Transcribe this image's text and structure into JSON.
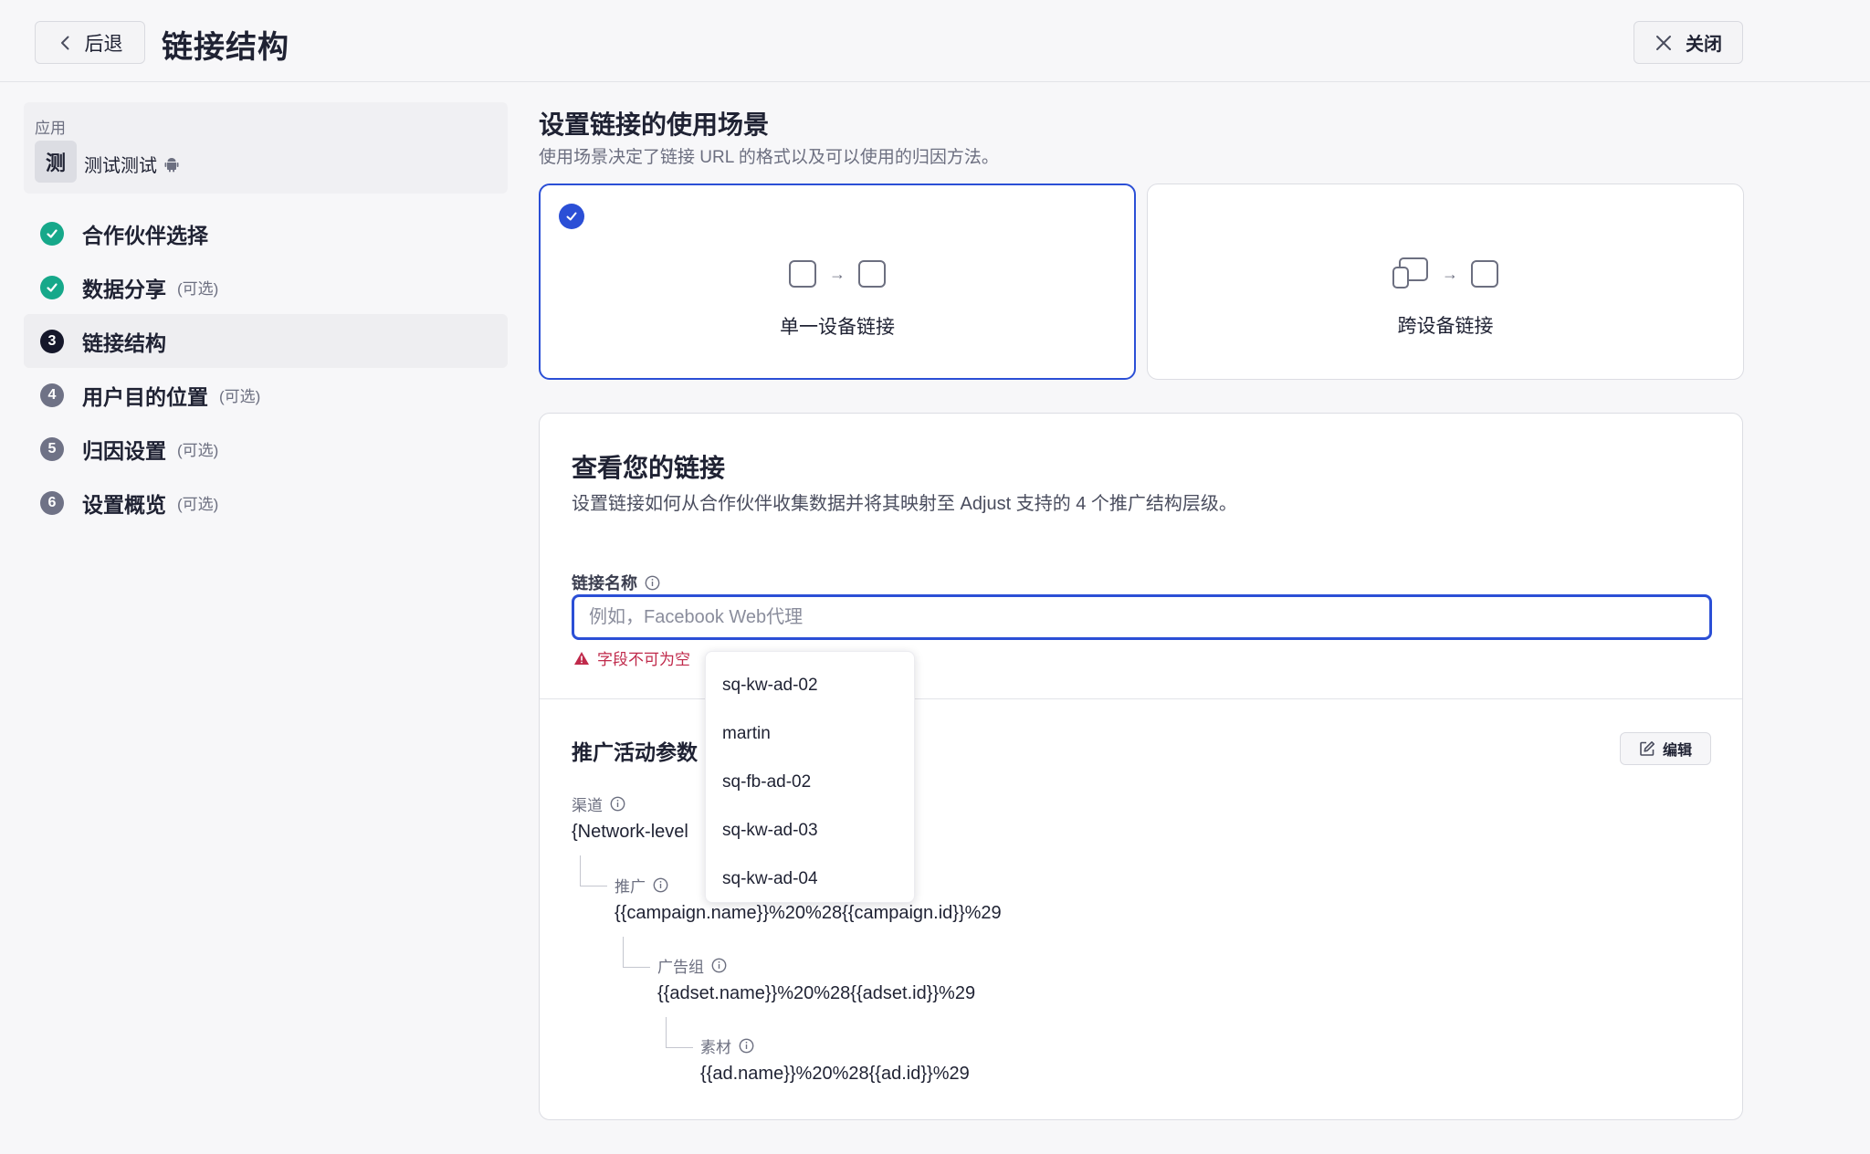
{
  "header": {
    "back_label": "后退",
    "title": "链接结构",
    "close_label": "关闭"
  },
  "app": {
    "label": "应用",
    "avatar": "测",
    "name": "测试测试"
  },
  "steps": [
    {
      "label": "合作伙伴选择",
      "status": "done",
      "optional": ""
    },
    {
      "label": "数据分享",
      "status": "done",
      "optional": "(可选)"
    },
    {
      "label": "链接结构",
      "status": "current",
      "number": "3",
      "optional": ""
    },
    {
      "label": "用户目的位置",
      "status": "todo",
      "number": "4",
      "optional": "(可选)"
    },
    {
      "label": "归因设置",
      "status": "todo",
      "number": "5",
      "optional": "(可选)"
    },
    {
      "label": "设置概览",
      "status": "todo",
      "number": "6",
      "optional": "(可选)"
    }
  ],
  "scenario_section": {
    "title": "设置链接的使用场景",
    "description": "使用场景决定了链接 URL 的格式以及可以使用的归因方法。",
    "options": [
      {
        "label": "单一设备链接",
        "selected": true
      },
      {
        "label": "跨设备链接",
        "selected": false
      }
    ]
  },
  "link_card": {
    "title": "查看您的链接",
    "description": "设置链接如何从合作伙伴收集数据并将其映射至 Adjust 支持的 4 个推广结构层级。",
    "name_field": {
      "label": "链接名称",
      "value": "",
      "placeholder": "例如，Facebook Web代理",
      "error": "字段不可为空"
    },
    "campaign_params": {
      "title": "推广活动参数",
      "edit_label": "编辑",
      "channel": {
        "label": "渠道",
        "value": "{Network-level"
      },
      "campaign": {
        "label": "推广",
        "value": "{{campaign.name}}%20%28{{campaign.id}}%29"
      },
      "adgroup": {
        "label": "广告组",
        "value": "{{adset.name}}%20%28{{adset.id}}%29"
      },
      "creative": {
        "label": "素材",
        "value": "{{ad.name}}%20%28{{ad.id}}%29"
      }
    }
  },
  "dropdown": {
    "items": [
      "sq-kw-ad-02",
      "martin",
      "sq-fb-ad-02",
      "sq-kw-ad-03",
      "sq-kw-ad-04"
    ]
  },
  "colors": {
    "accent": "#2b4fd6",
    "success": "#16a88a",
    "error": "#c02a4b"
  }
}
